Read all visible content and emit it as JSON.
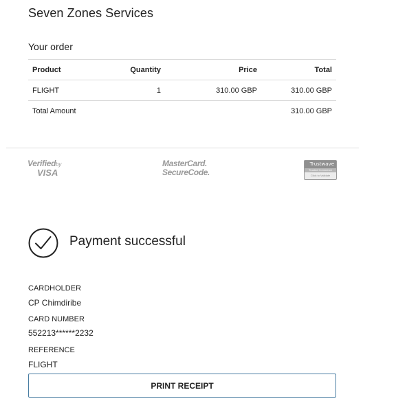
{
  "merchant": {
    "name": "Seven Zones Services"
  },
  "order": {
    "heading": "Your order",
    "columns": [
      "Product",
      "Quantity",
      "Price",
      "Total"
    ],
    "rows": [
      {
        "product": "FLIGHT",
        "quantity": "1",
        "price": "310.00 GBP",
        "total": "310.00 GBP"
      }
    ],
    "total_label": "Total Amount",
    "total_value": "310.00 GBP"
  },
  "security_logos": {
    "visa": {
      "line1": "Verified",
      "line1_small": "by",
      "line2": "VISA"
    },
    "mastercard": {
      "line1": "MasterCard.",
      "line2": "SecureCode."
    },
    "trustwave": {
      "top": "Trustwave",
      "mid": "Trusted Commerce",
      "bottom": "Click to Validate"
    }
  },
  "status": {
    "message": "Payment successful",
    "icon": "check-circle-icon"
  },
  "details": {
    "cardholder_label": "CARDHOLDER",
    "cardholder_value": "CP Chimdiribe",
    "card_number_label": "CARD NUMBER",
    "card_number_value": "552213******2232",
    "reference_label": "REFERENCE",
    "reference_value": "FLIGHT"
  },
  "actions": {
    "print_label": "PRINT RECEIPT"
  },
  "colors": {
    "button_border": "#4a7ea3",
    "divider": "#dedede",
    "logo_gray": "#9a9a9a"
  }
}
